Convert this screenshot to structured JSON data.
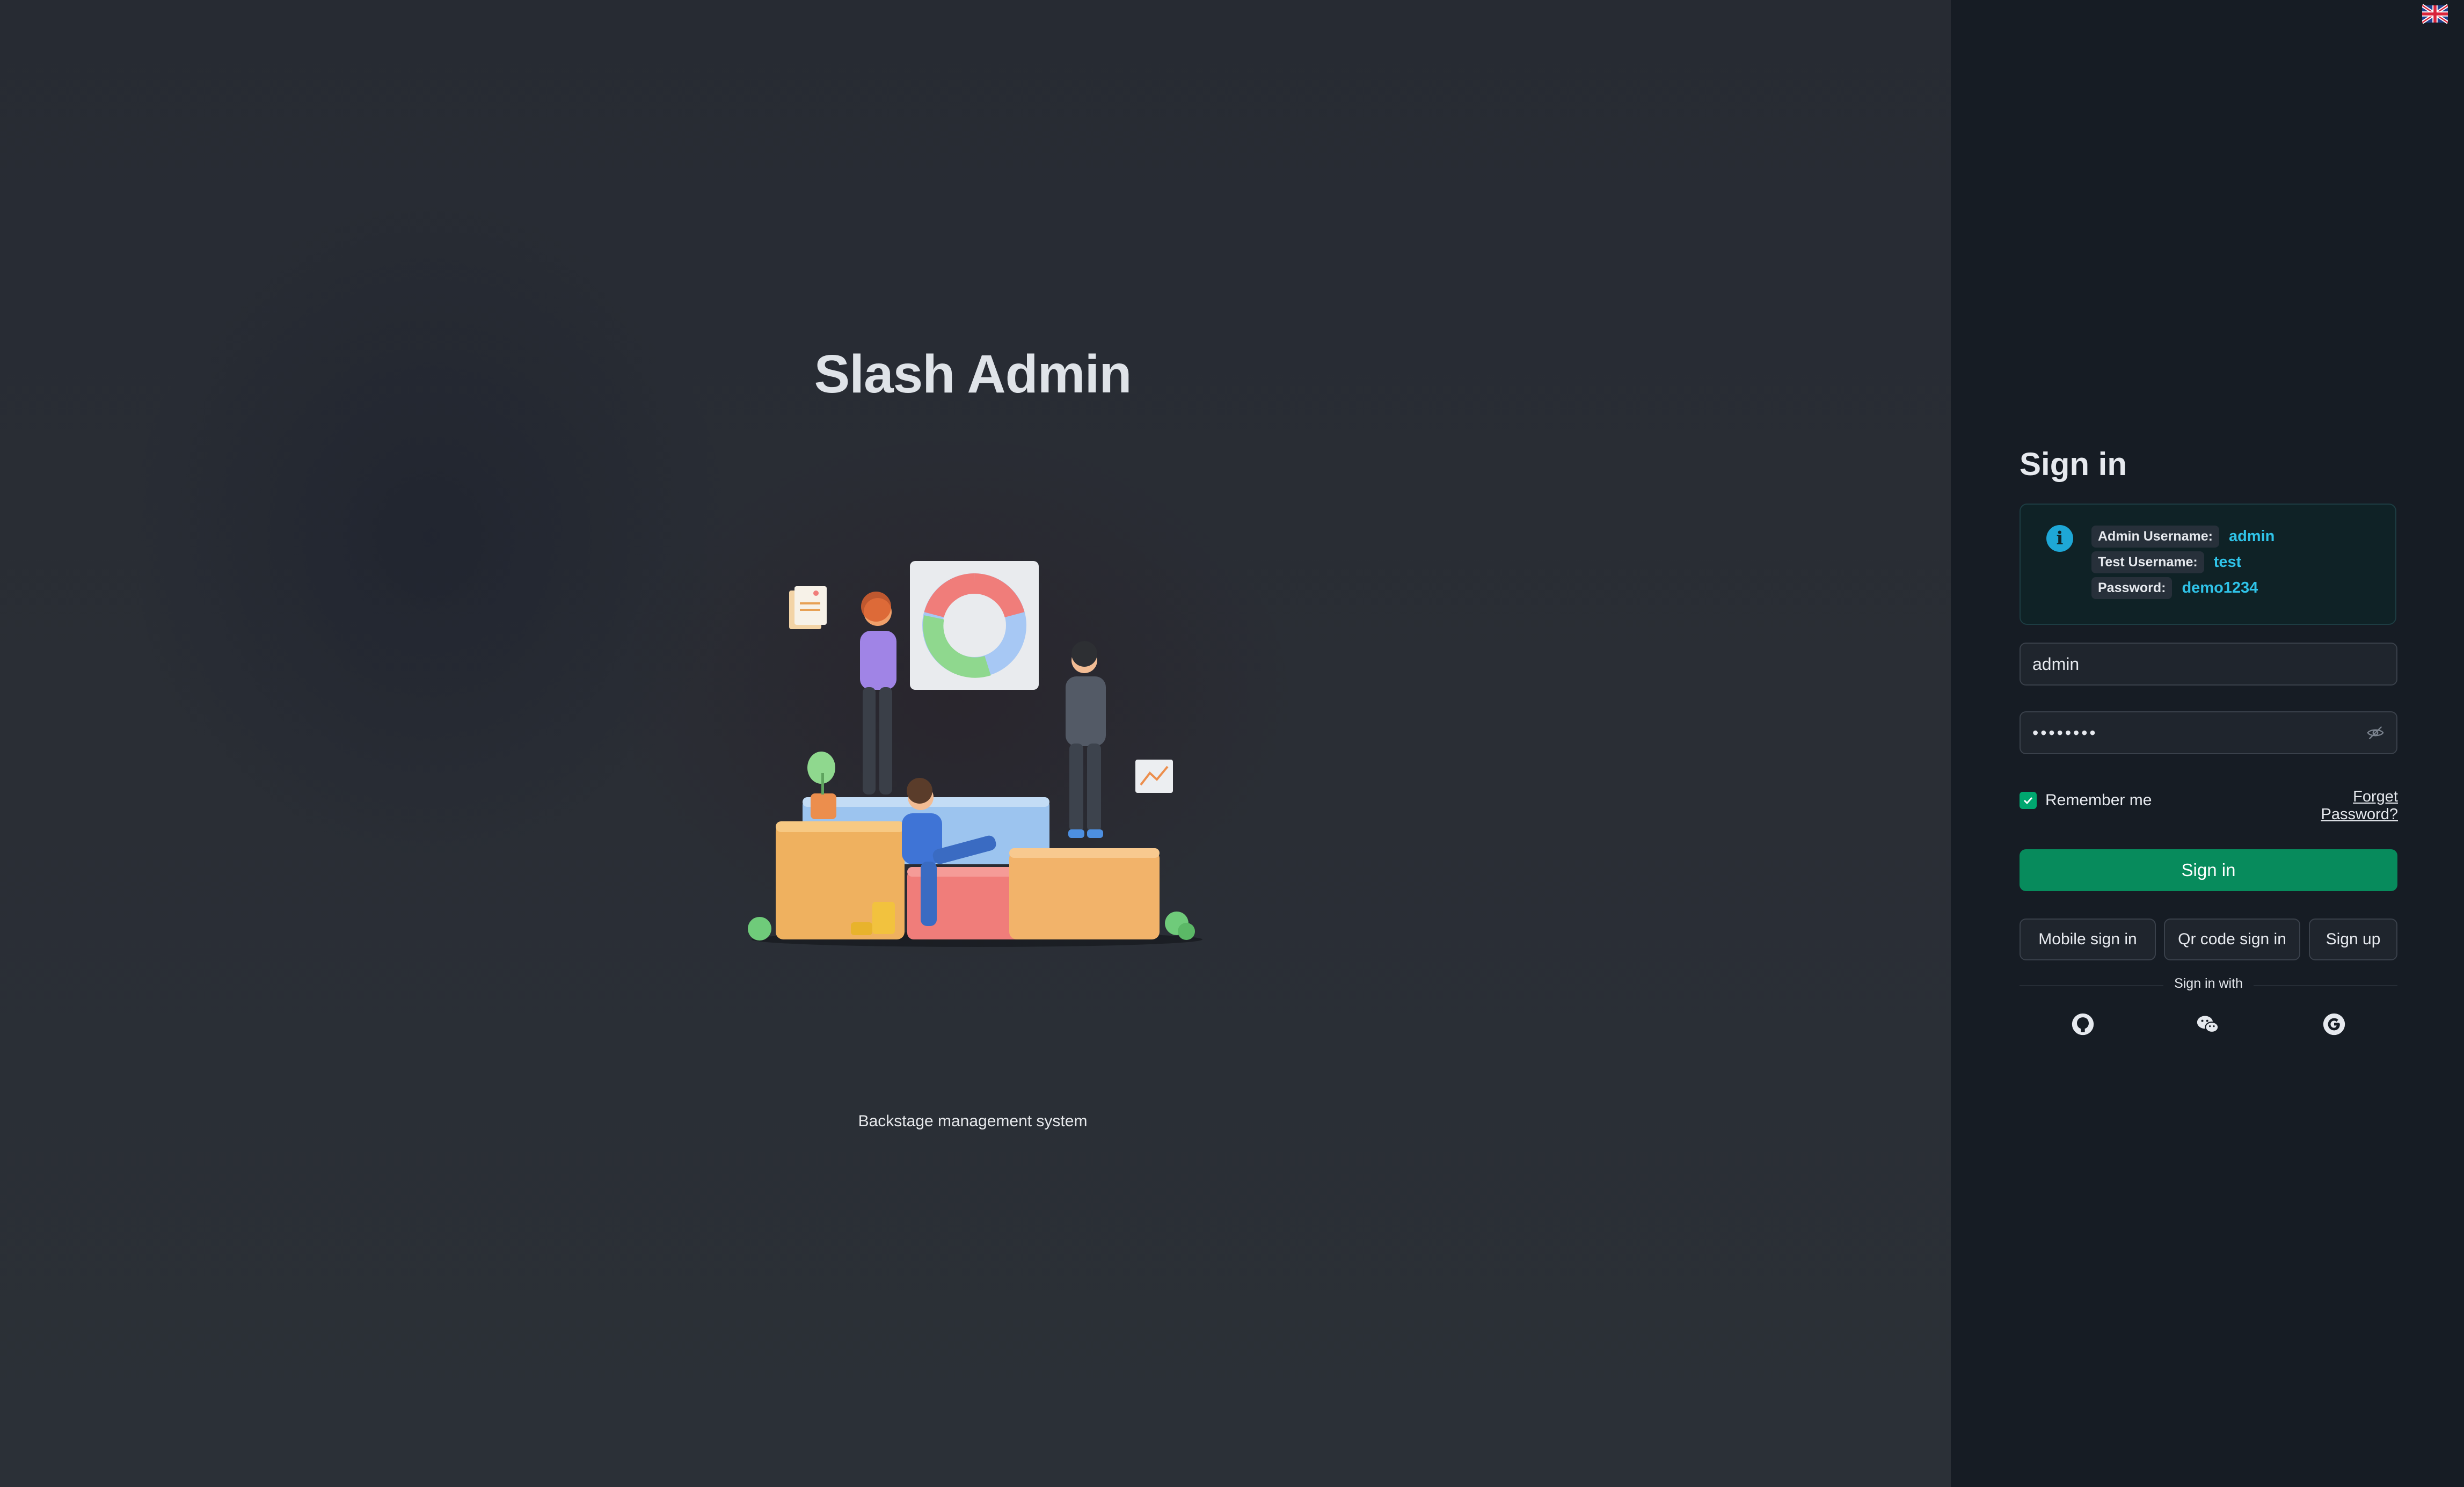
{
  "brand": {
    "title": "Slash Admin",
    "subtitle": "Backstage management system"
  },
  "header": {
    "language_icon": "uk-flag-icon"
  },
  "signin": {
    "title": "Sign in",
    "info": {
      "icon": "info-icon",
      "rows": [
        {
          "label": "Admin Username:",
          "value": "admin"
        },
        {
          "label": "Test Username:",
          "value": "test"
        },
        {
          "label": "Password:",
          "value": "demo1234"
        }
      ]
    },
    "username_value": "admin",
    "password_value": "••••••••",
    "password_toggle_icon": "eye-off-icon",
    "remember_me": {
      "label": "Remember me",
      "checked": true
    },
    "forgot_password": "Forget Password?",
    "submit_label": "Sign in",
    "alt_buttons": {
      "mobile": "Mobile sign in",
      "qr": "Qr code sign in",
      "signup": "Sign up"
    },
    "social": {
      "label": "Sign in with",
      "icons": [
        "github-icon",
        "wechat-icon",
        "google-icon"
      ]
    }
  },
  "colors": {
    "accent": "#00a76f",
    "button": "#078b5c",
    "info": "#2fc3e8",
    "panel_bg": "#161c24"
  }
}
